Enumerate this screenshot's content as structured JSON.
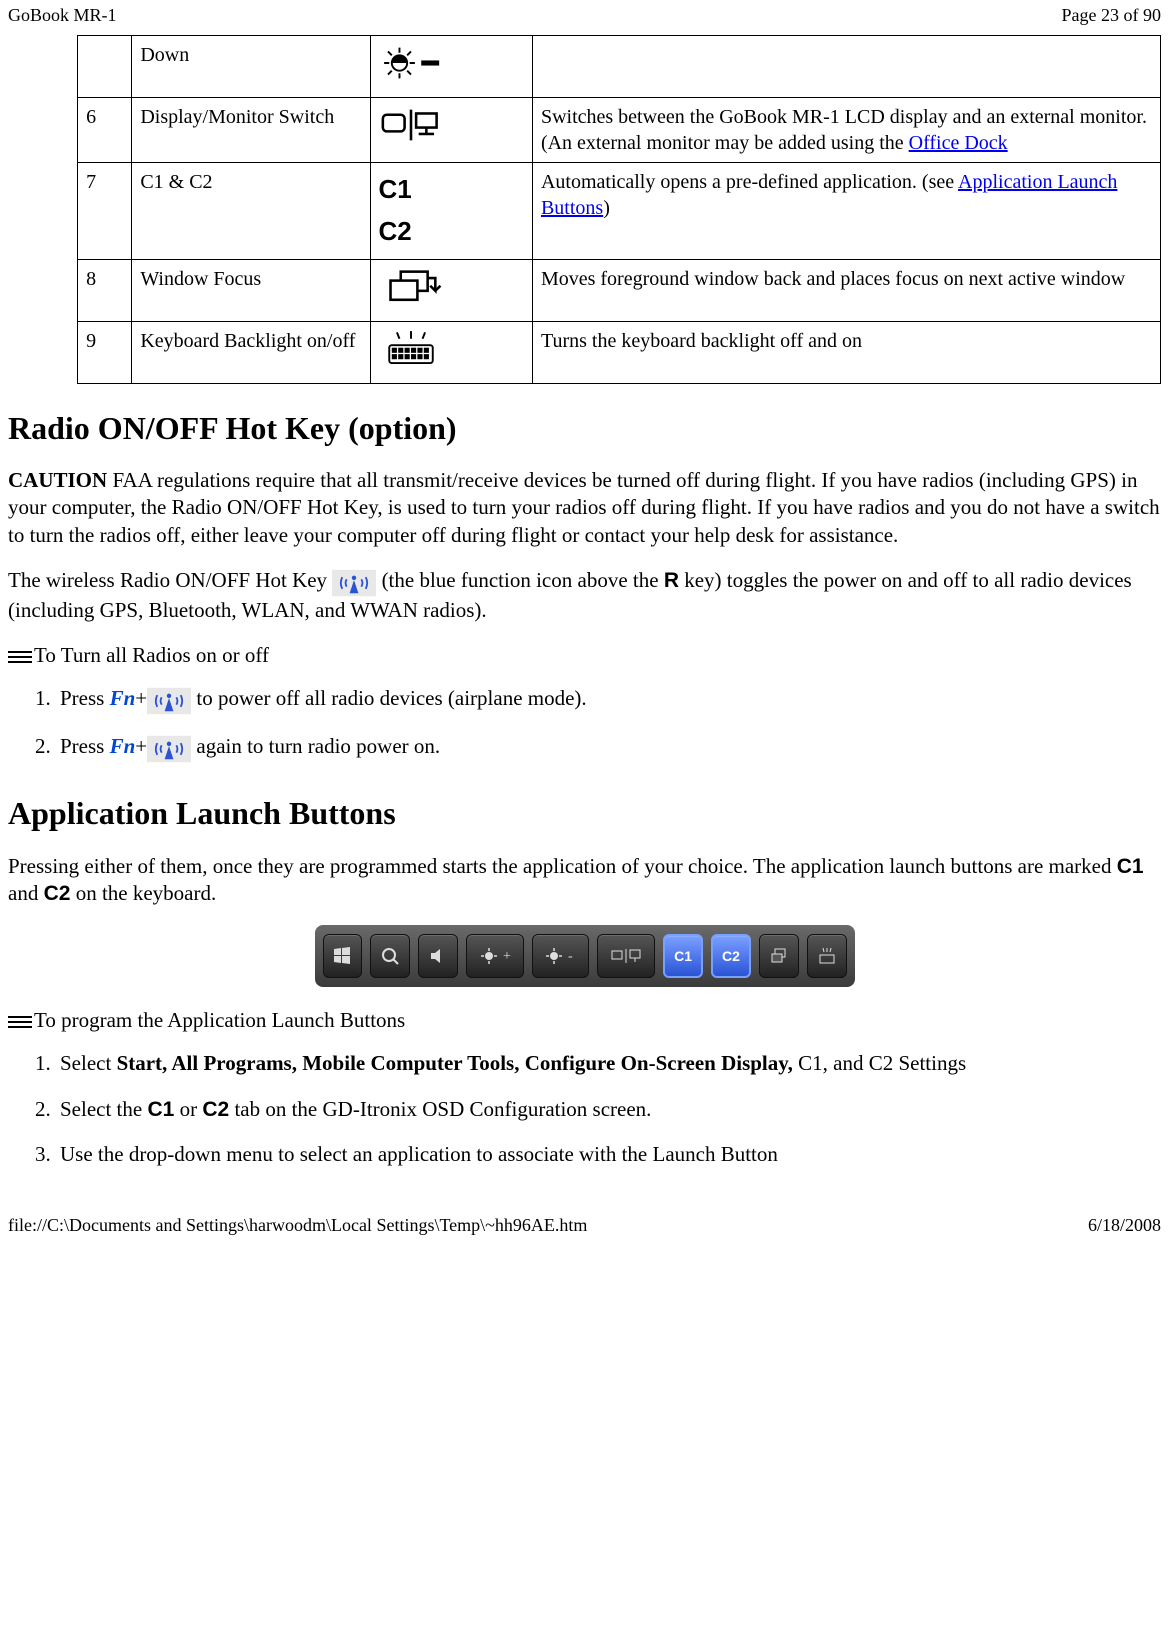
{
  "header": {
    "doc_title": "GoBook MR-1",
    "page_indicator": "Page 23 of 90"
  },
  "table_rows": {
    "r5": {
      "num": "",
      "name": "Down",
      "desc": ""
    },
    "r6": {
      "num": "6",
      "name": "Display/Monitor Switch",
      "desc_a": "Switches between the GoBook MR-1 LCD display and an external monitor.  (An external monitor may be added using the ",
      "link": "Office Dock"
    },
    "r7": {
      "num": "7",
      "name": "C1 & C2",
      "icon_line1": "C1",
      "icon_line2": "C2",
      "desc_a": "Automatically opens a pre-defined application.  (see ",
      "link": "Application Launch Buttons",
      "desc_b": ")"
    },
    "r8": {
      "num": "8",
      "name": "Window Focus",
      "desc": "Moves foreground window back and places focus on next active window"
    },
    "r9": {
      "num": "9",
      "name": "Keyboard Backlight on/off",
      "desc": "Turns the keyboard backlight off and on"
    }
  },
  "radio_section": {
    "heading": "Radio ON/OFF Hot Key (option)",
    "caution_label": "CAUTION",
    "caution_text": "  FAA regulations require that all transmit/receive devices be turned off during flight.  If you have radios (including GPS) in your computer, the Radio ON/OFF Hot Key, is used to turn your radios off during flight.  If you have radios and you do not have a switch to turn the radios off, either leave your computer off during flight or contact your help desk for assistance.",
    "para2_a": "The wireless Radio ON/OFF Hot Key ",
    "para2_b": " (the blue function icon above the ",
    "r_key": "R",
    "para2_c": " key) toggles the power on and off to all radio devices (including GPS, Bluetooth, WLAN, and WWAN radios).",
    "subhead1": "To Turn all Radios on or off",
    "step1_a": "Press ",
    "fn": "Fn",
    "step1_b": "+",
    "step1_c": " to power off all radio devices (airplane mode).",
    "step2_a": "Press ",
    "step2_b": "+",
    "step2_c": " again to turn radio power on."
  },
  "app_section": {
    "heading": "Application Launch Buttons",
    "para1_a": "Pressing either of them, once they are programmed starts the application of your choice.  The application launch buttons are marked ",
    "c1": "C1",
    "and": " and ",
    "c2": "C2",
    "para1_b": " on the keyboard.",
    "subhead1": " To program the Application Launch Buttons",
    "step1_a": "Select ",
    "step1_b": "Start, All Programs, Mobile Computer Tools, Configure On-Screen Display, ",
    "step1_c": "C1",
    "step1_d": ", and C2 Settings",
    "step2_a": "Select the ",
    "step2_b": "C1",
    "step2_c": " or ",
    "step2_d": "C2",
    "step2_e": " tab on the GD-Itronix OSD Configuration screen.",
    "step3": "Use the drop-down menu to select an application to associate with the Launch Button"
  },
  "footer": {
    "path": "file://C:\\Documents and Settings\\harwoodm\\Local Settings\\Temp\\~hh96AE.htm",
    "date": "6/18/2008"
  },
  "strip_labels": {
    "c1": "C1",
    "c2": "C2"
  }
}
